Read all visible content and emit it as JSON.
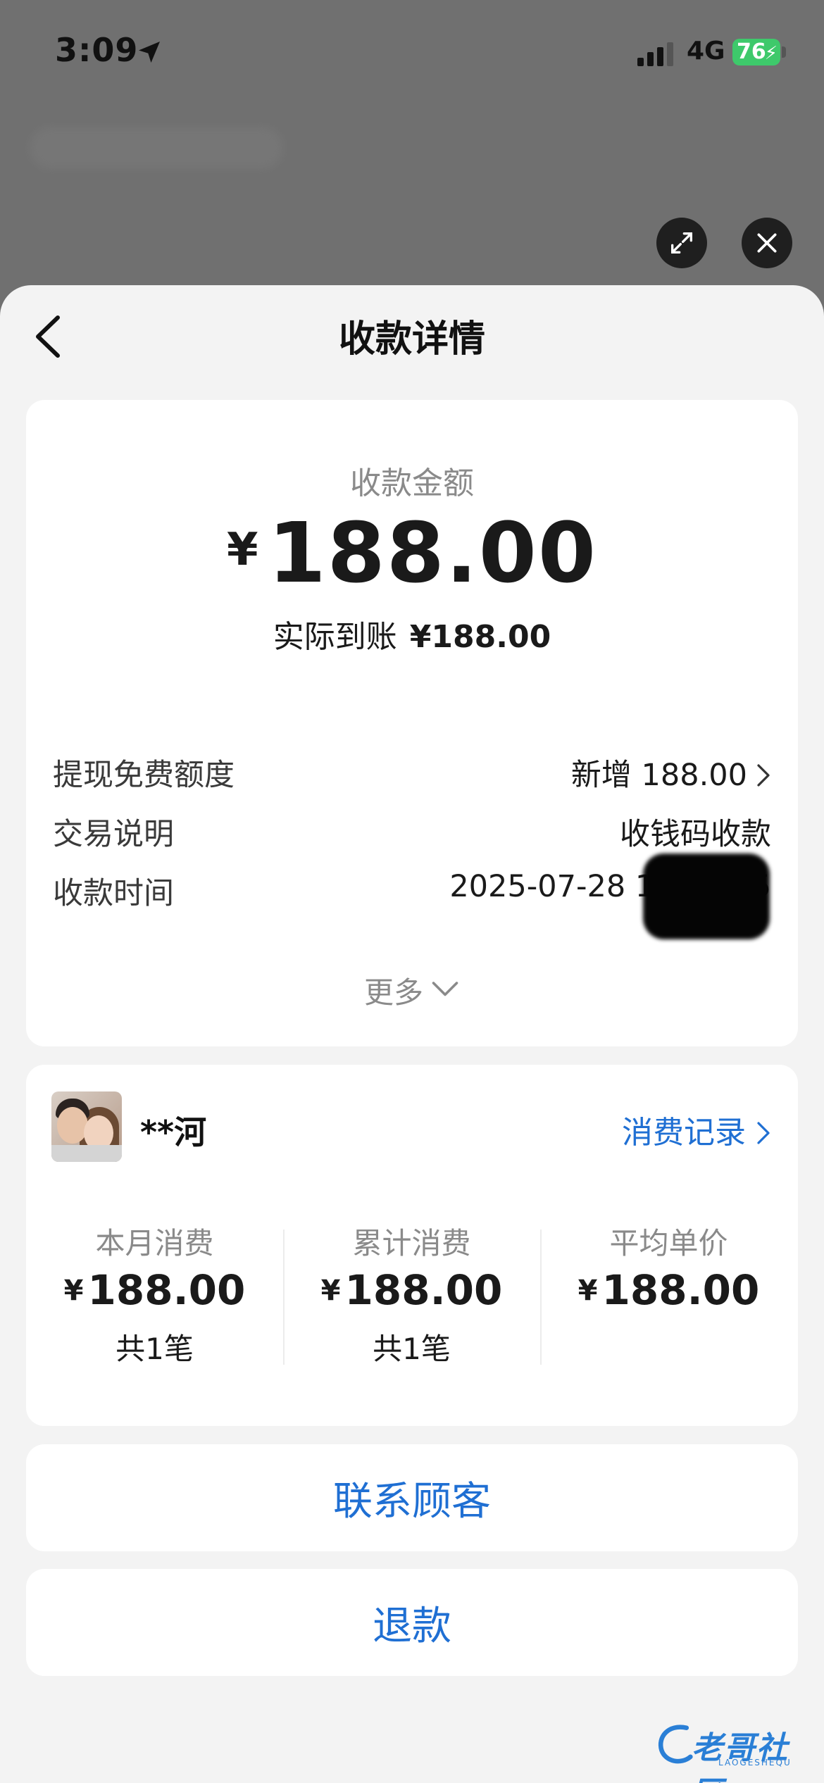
{
  "status_bar": {
    "time": "3:09",
    "network": "4G",
    "battery": "76"
  },
  "sheet": {
    "title": "收款详情"
  },
  "amount": {
    "label": "收款金额",
    "currency": "¥",
    "value": "188.00",
    "received_label": "实际到账",
    "received_value": "¥188.00"
  },
  "details": [
    {
      "label": "提现免费额度",
      "value": "新增 188.00"
    },
    {
      "label": "交易说明",
      "value": "收钱码收款"
    },
    {
      "label": "收款时间",
      "value": "2025-07-28 15:08:05"
    }
  ],
  "more_label": "更多",
  "customer": {
    "name": "**河",
    "records_link": "消费记录",
    "stats": [
      {
        "label": "本月消费",
        "currency": "¥",
        "amount": "188.00",
        "count": "共1笔"
      },
      {
        "label": "累计消费",
        "currency": "¥",
        "amount": "188.00",
        "count": "共1笔"
      },
      {
        "label": "平均单价",
        "currency": "¥",
        "amount": "188.00",
        "count": ""
      }
    ]
  },
  "actions": {
    "contact": "联系顾客",
    "refund": "退款"
  },
  "watermark": {
    "text": "老哥社区",
    "sub": "LAOGESHEQU"
  },
  "colors": {
    "accent": "#1f6fd3",
    "battery": "#3ec96b",
    "sheet_bg": "#f3f3f3"
  }
}
